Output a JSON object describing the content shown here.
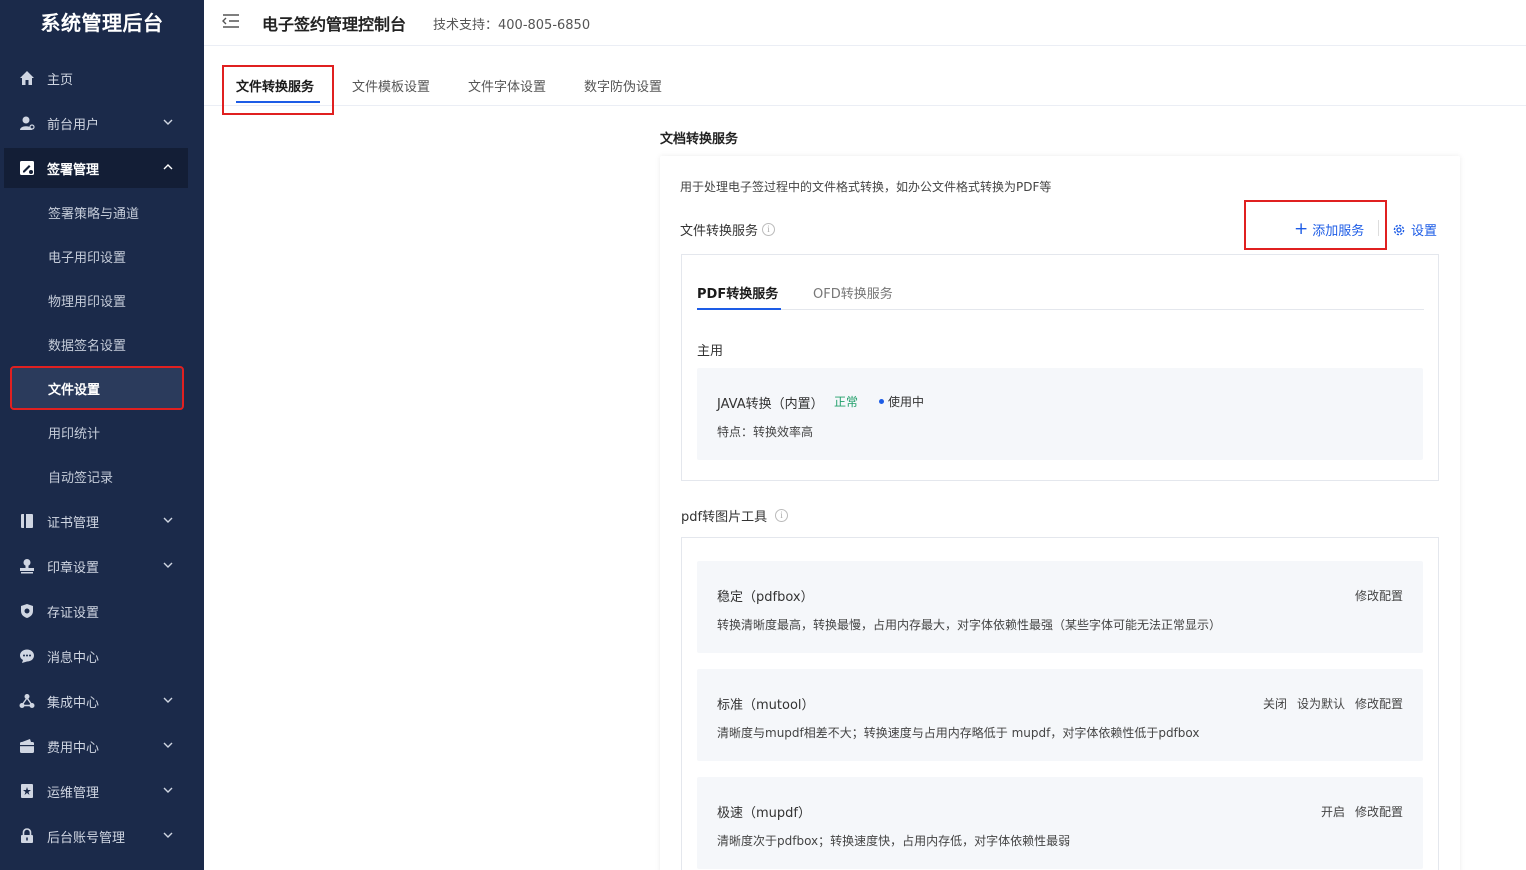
{
  "sidebar": {
    "logo": "系统管理后台",
    "items": [
      {
        "label": "主页"
      },
      {
        "label": "前台用户"
      },
      {
        "label": "签署管理"
      },
      {
        "label": "证书管理"
      },
      {
        "label": "印章设置"
      },
      {
        "label": "存证设置"
      },
      {
        "label": "消息中心"
      },
      {
        "label": "集成中心"
      },
      {
        "label": "费用中心"
      },
      {
        "label": "运维管理"
      },
      {
        "label": "后台账号管理"
      }
    ],
    "sub_items": [
      {
        "label": "签署策略与通道"
      },
      {
        "label": "电子用印设置"
      },
      {
        "label": "物理用印设置"
      },
      {
        "label": "数据签名设置"
      },
      {
        "label": "文件设置"
      },
      {
        "label": "用印统计"
      },
      {
        "label": "自动签记录"
      }
    ]
  },
  "header": {
    "title": "电子签约管理控制台",
    "support": "技术支持：400-805-6850"
  },
  "tabs": [
    {
      "label": "文件转换服务"
    },
    {
      "label": "文件模板设置"
    },
    {
      "label": "文件字体设置"
    },
    {
      "label": "数字防伪设置"
    }
  ],
  "main": {
    "section_title": "文档转换服务",
    "description": "用于处理电子签过程中的文件格式转换，如办公文件格式转换为PDF等",
    "service_label": "文件转换服务",
    "add_service": "添加服务",
    "settings": "设置",
    "inner_tabs": [
      {
        "label": "PDF转换服务"
      },
      {
        "label": "OFD转换服务"
      }
    ],
    "primary_label": "主用",
    "engine": {
      "name": "JAVA转换（内置）",
      "status": "正常",
      "in_use": "使用中",
      "feature": "特点：转换效率高"
    },
    "tool_label": "pdf转图片工具",
    "tools": [
      {
        "name": "稳定（pdfbox）",
        "desc": "转换清晰度最高，转换最慢，占用内存最大，对字体依赖性最强（某些字体可能无法正常显示）",
        "actions": [
          "修改配置"
        ]
      },
      {
        "name": "标准（mutool）",
        "desc": "清晰度与mupdf相差不大；转换速度与占用内存略低于 mupdf，对字体依赖性低于pdfbox",
        "actions": [
          "关闭",
          "设为默认",
          "修改配置"
        ]
      },
      {
        "name": "极速（mupdf）",
        "desc": "清晰度次于pdfbox；转换速度快，占用内存低，对字体依赖性最弱",
        "actions": [
          "开启",
          "修改配置"
        ]
      }
    ]
  },
  "colors": {
    "sidebar_bg": "#1b2a4a",
    "accent": "#1d5ce6",
    "highlight_border": "#e02020",
    "status_ok": "#22a06b"
  }
}
